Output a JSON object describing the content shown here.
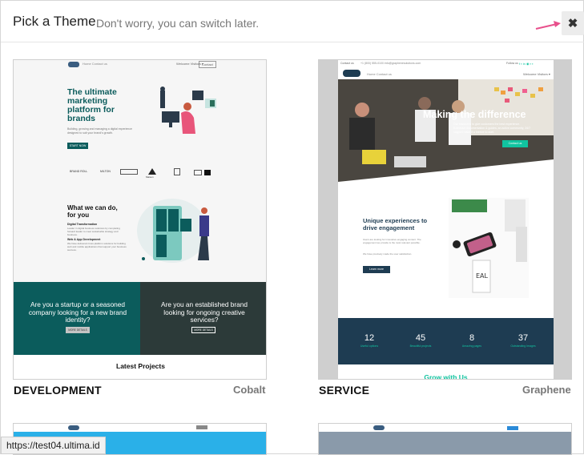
{
  "header": {
    "title": "Pick a Theme",
    "subtitle": "Don't worry, you can switch later.",
    "close_label": "✖"
  },
  "themes": [
    {
      "category": "DEVELOPMENT",
      "name": "Cobalt",
      "preview": {
        "nav_links": "Home   Contact us",
        "nav_right": "Welcome Visitors ▾",
        "nav_button": "Contact",
        "hero_title": "The ultimate marketing platform for brands",
        "hero_text": "Building, growing and managing a digital experience designed to suit your brand's growth.",
        "hero_button": "START NOW",
        "logos": [
          "BRAND ROLL",
          "MILTON",
          "",
          "Maison",
          "",
          ""
        ],
        "section_title": "What we can do, for you",
        "sub1_title": "Digital Transformation",
        "sub1_text": "Leader in digital business solutions by completing forward leader to meet sustainable strategy and business.",
        "sub2_title": "Web & App Development",
        "sub2_text": "We have delivered cross-platform solutions for building web and mobile applications that support your business success.",
        "cta_left": "Are you a startup or a seasoned company looking for a new brand identity?",
        "cta_left_button": "MORE DETAILS",
        "cta_right": "Are you an established brand looking for ongoing creative services?",
        "cta_right_button": "MORE DETAILS",
        "footer_title": "Latest Projects"
      }
    },
    {
      "category": "SERVICE",
      "name": "Graphene",
      "preview": {
        "top_left": "Contact us",
        "top_mid": "+1 (800) 555-0100   info@graphenesolutions.com",
        "top_right": "Follow us",
        "nav_links": "Home   Contact us",
        "nav_right": "Welcome Visitors ▾",
        "hero_title": "Making the difference",
        "hero_text": "Our mission is to give customers the best experience. Extensive documentation & guides, an active community, 24/7 support make it a breeze to start.",
        "hero_button": "Contact us",
        "section_title": "Unique experiences to drive engagement",
        "section_text": "Users are looking for innovative engaging content. The engagement we provide is the most relevant possible.",
        "section_text2": "We have precisely made the user satisfaction.",
        "section_button": "Learn more",
        "stats": [
          {
            "value": "12",
            "label": "Useful options"
          },
          {
            "value": "45",
            "label": "Beautiful projects"
          },
          {
            "value": "8",
            "label": "Amazing pages"
          },
          {
            "value": "37",
            "label": "Outstanding Images"
          }
        ],
        "footer_title": "Grow with Us"
      }
    }
  ],
  "status_bar": {
    "url": "https://test04.ultima.id"
  },
  "colors": {
    "cobalt_teal": "#0b5c5c",
    "cobalt_dark": "#2c3a39",
    "graphene_green": "#11c4a0",
    "graphene_navy": "#1e3c52",
    "graphene_gray": "#cfcfcf",
    "arrow_pink": "#e8508c"
  }
}
